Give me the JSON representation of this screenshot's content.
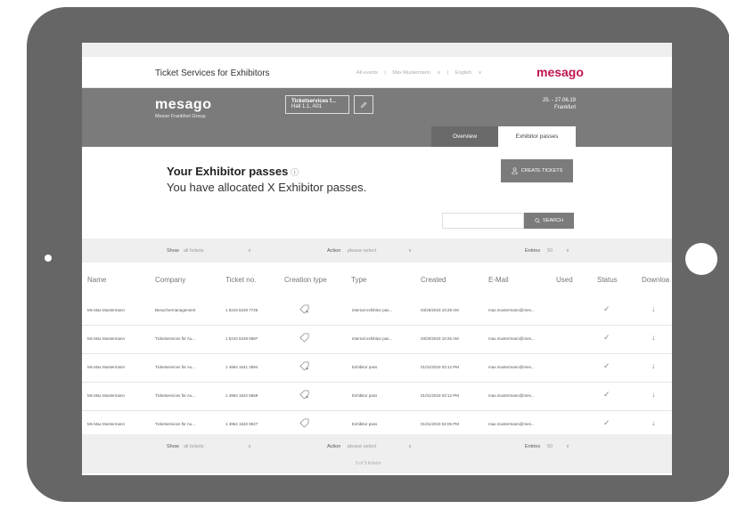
{
  "header": {
    "service_title": "Ticket Services for Exhibitors",
    "menu": [
      "All events",
      "|",
      "Max Mustermann",
      "∨",
      "|",
      "English",
      "∨"
    ],
    "brand": "mesago"
  },
  "band": {
    "logo": "mesago",
    "logo_sub": "Messe Frankfurt Group",
    "ticket_box_line1": "Ticketservices f...",
    "ticket_box_line2": "Hall 1.1, A01",
    "date_range": "25. - 27.06.19",
    "city": "Frankfurt",
    "tabs": [
      "Overview",
      "Exhibitor passes"
    ]
  },
  "main": {
    "title": "Your Exhibitor passes",
    "info_icon": "ⓘ",
    "subtitle": "You have allocated X Exhibitor passes.",
    "create_label": "CREATE TICKETS",
    "search_label": "SEARCH",
    "search_value": ""
  },
  "filter": {
    "show_label": "Show",
    "show_value": "all tickets",
    "action_label": "Action",
    "action_value": "please select",
    "entries_label": "Entries",
    "entries_value": "50"
  },
  "table": {
    "columns": [
      "Name",
      "Company",
      "Ticket no.",
      "Creation type",
      "Type",
      "Created",
      "E-Mail",
      "Used",
      "Status",
      "Downloa"
    ],
    "rows": [
      {
        "name": "Ms Max Mustermann",
        "company": "Besuchermanagement",
        "ticket": "1 5243 6229 7726",
        "creation_icon": "tag-plus",
        "type": "internal exhibitor pas...",
        "created": "03/25/2019 10:28 AM",
        "email": "max.mustermann@mes...",
        "used": "",
        "status": "✓",
        "download": "↓"
      },
      {
        "name": "Ms Max Mustermann",
        "company": "Ticketservices für Au...",
        "ticket": "1 5243 6228 5587",
        "creation_icon": "tag",
        "type": "internal exhibitor pas...",
        "created": "03/20/2019 10:26 AM",
        "email": "max.mustermann@mes...",
        "used": "",
        "status": "✓",
        "download": "↓"
      },
      {
        "name": "Ms Max Mustermann",
        "company": "Ticketservices für Au...",
        "ticket": "1 4964 1541 4994",
        "creation_icon": "tag-plus",
        "type": "Exhibitor pass",
        "created": "01/31/2019 03:12 PM",
        "email": "max.mustermann@mes...",
        "used": "",
        "status": "✓",
        "download": "↓"
      },
      {
        "name": "Ms Max Mustermann",
        "company": "Ticketservices für Au...",
        "ticket": "1 4964 1542 6659",
        "creation_icon": "tag-plus",
        "type": "Exhibitor pass",
        "created": "01/31/2019 03:12 PM",
        "email": "max.mustermann@mes...",
        "used": "",
        "status": "✓",
        "download": "↓"
      },
      {
        "name": "Ms Max Mustermann",
        "company": "Ticketservices für Au...",
        "ticket": "1 4964 1540 9927",
        "creation_icon": "tag",
        "type": "Exhibitor pass",
        "created": "01/31/2019 02:06 PM",
        "email": "max.mustermann@mes...",
        "used": "",
        "status": "✓",
        "download": "↓"
      }
    ]
  },
  "pager": "5 of 5 tickets",
  "colors": {
    "brand": "#c0154f",
    "band": "#7b7b7b",
    "tablet": "#666666"
  }
}
